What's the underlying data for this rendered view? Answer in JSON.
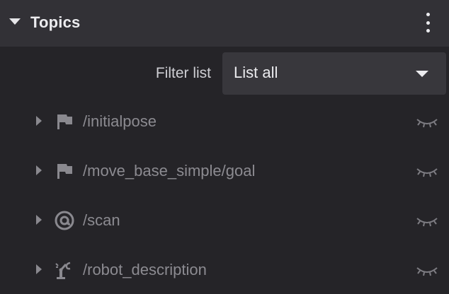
{
  "header": {
    "title": "Topics",
    "collapse_icon": "caret-down-icon",
    "menu_icon": "more-vertical-icon"
  },
  "filter": {
    "label": "Filter list",
    "selected": "List all",
    "dropdown_icon": "chevron-down-icon"
  },
  "topics": [
    {
      "name": "/initialpose",
      "icon": "flag-icon",
      "visibility_icon": "eye-closed-icon"
    },
    {
      "name": "/move_base_simple/goal",
      "icon": "flag-icon",
      "visibility_icon": "eye-closed-icon"
    },
    {
      "name": "/scan",
      "icon": "at-sign-icon",
      "visibility_icon": "eye-closed-icon"
    },
    {
      "name": "/robot_description",
      "icon": "robot-arm-icon",
      "visibility_icon": "eye-closed-icon"
    }
  ],
  "colors": {
    "background": "#252428",
    "header_background": "#323136",
    "select_background": "#38373c",
    "text_primary": "#ececef",
    "text_muted": "#8c8b91"
  }
}
